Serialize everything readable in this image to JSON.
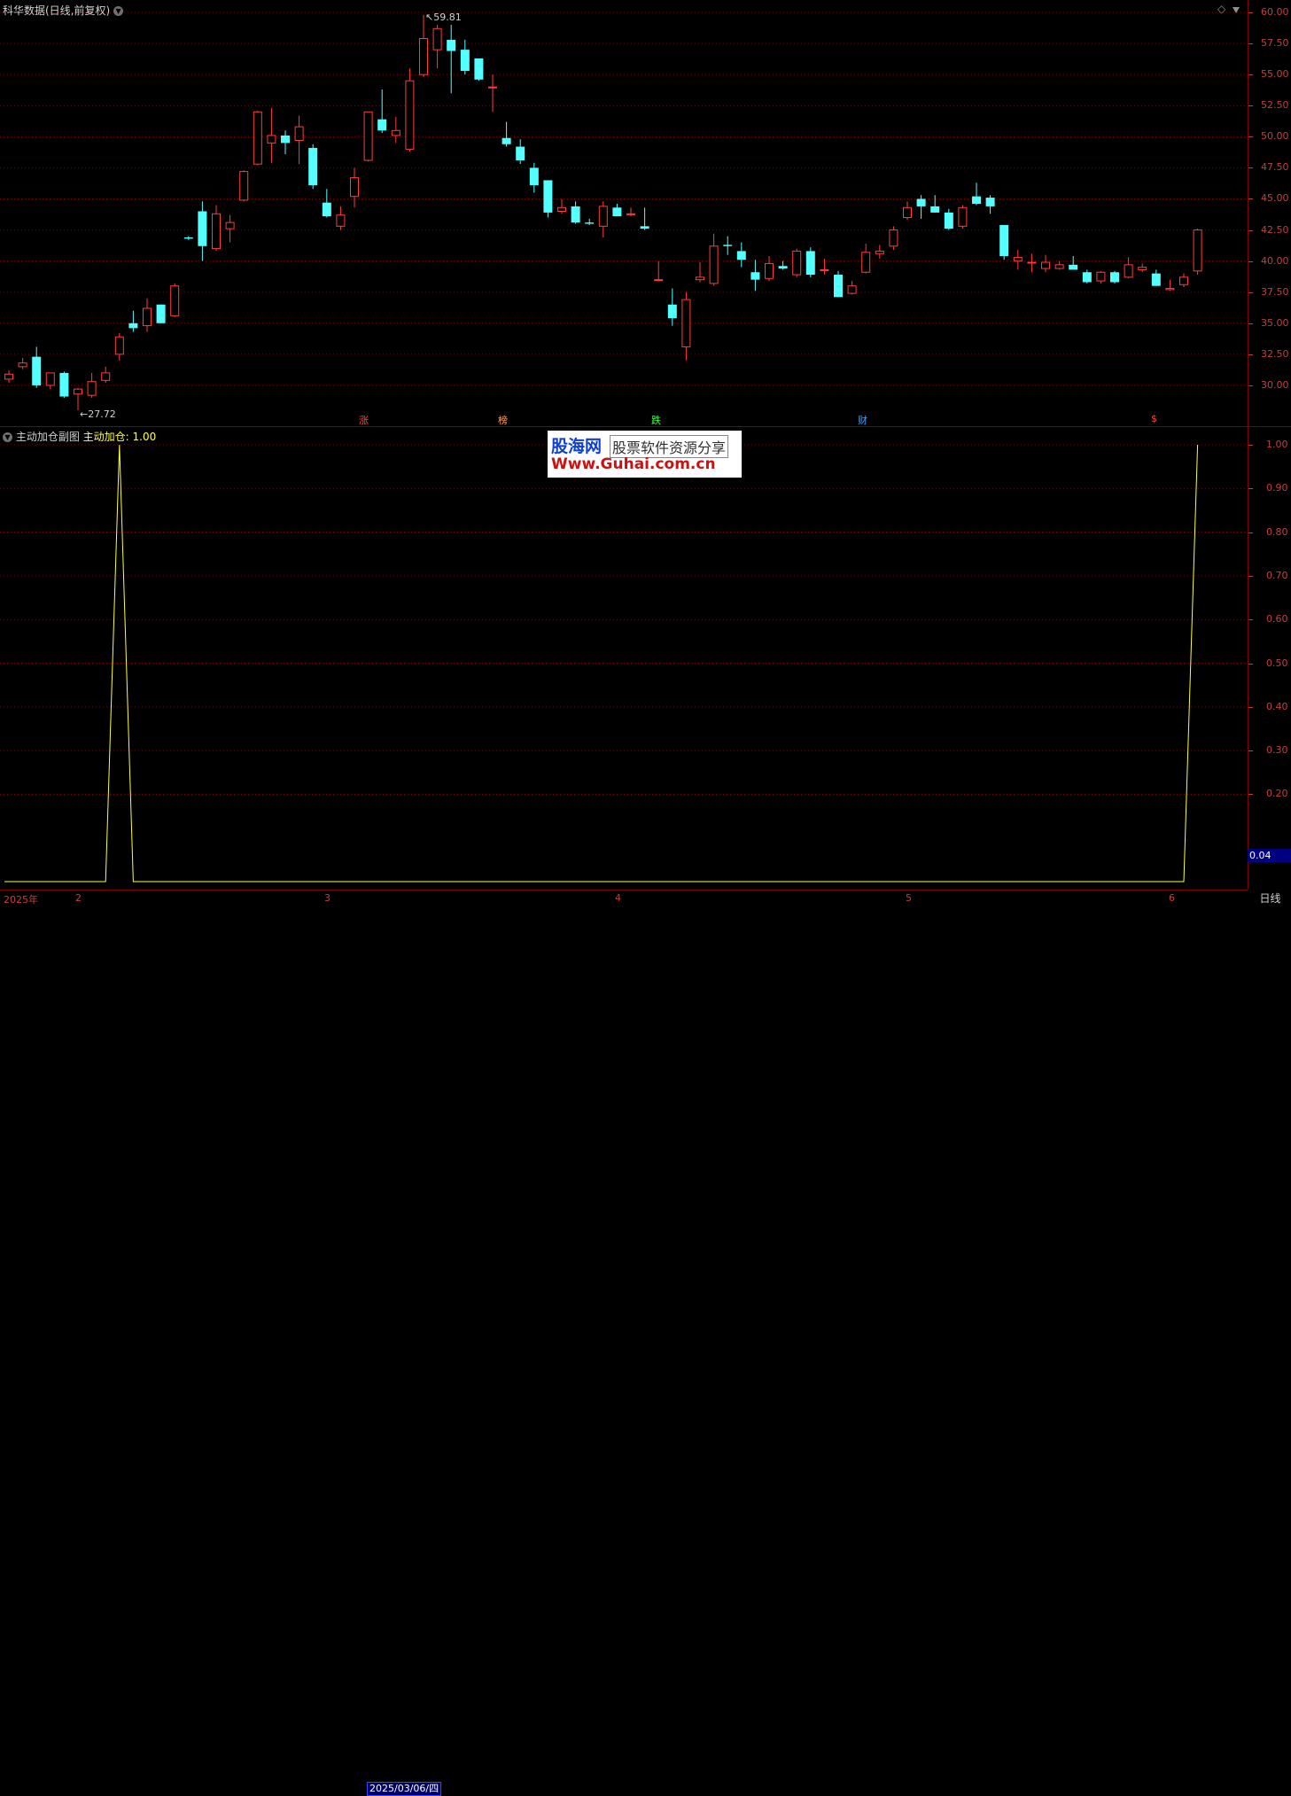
{
  "main_panel": {
    "title": "科华数据(日线,前复权)",
    "high_marker": "59.81",
    "low_marker": "27.72",
    "y_ticks": [
      "60.00",
      "57.50",
      "55.00",
      "52.50",
      "50.00",
      "47.50",
      "45.00",
      "42.50",
      "40.00",
      "37.50",
      "35.00",
      "32.50",
      "30.00"
    ],
    "event_tags": [
      {
        "label": "涨",
        "color": "#ff4040"
      },
      {
        "label": "榜",
        "color": "#ffa040"
      },
      {
        "label": "跌",
        "color": "#40ff40"
      },
      {
        "label": "财",
        "color": "#40a0ff"
      },
      {
        "label": "$",
        "color": "#ff4040"
      }
    ]
  },
  "sub_panel": {
    "title": "主动加仓副图",
    "indicator_label": "主动加仓: 1.00",
    "y_ticks": [
      "1.00",
      "0.90",
      "0.80",
      "0.70",
      "0.60",
      "0.50",
      "0.40",
      "0.30",
      "0.20"
    ],
    "last_value": "0.04"
  },
  "x_axis": {
    "labels": [
      "2025年",
      "2",
      "3",
      "2025/03/06/四",
      "4",
      "5",
      "6"
    ],
    "period": "日线"
  },
  "watermark": {
    "name": "股海网",
    "slogan": "股票软件资源分享",
    "url": "Www.Guhai.com.cn"
  },
  "colors": {
    "up": "#ff3c3c",
    "down": "#54ffff",
    "line": "#ffff40",
    "grid": "#800000"
  },
  "chart_data": [
    {
      "type": "candlestick",
      "title": "科华数据(日线,前复权)",
      "ylim": [
        27.0,
        61.0
      ],
      "series": [
        {
          "values": [
            [
              30.5,
              31.2,
              30.2,
              30.9
            ],
            [
              31.5,
              32.2,
              31.3,
              31.8
            ],
            [
              32.3,
              33.1,
              29.8,
              30.0
            ],
            [
              30.0,
              31.0,
              29.7,
              31.0
            ],
            [
              31.0,
              31.1,
              29.0,
              29.1
            ],
            [
              29.3,
              29.8,
              28.0,
              29.7
            ],
            [
              29.2,
              31.0,
              29.0,
              30.3
            ],
            [
              30.4,
              31.5,
              30.2,
              31.0
            ],
            [
              32.5,
              34.2,
              32.0,
              33.9
            ],
            [
              35.0,
              36.0,
              34.3,
              34.6
            ],
            [
              34.8,
              37.0,
              34.3,
              36.2
            ],
            [
              36.5,
              36.5,
              35.0,
              35.0
            ],
            [
              35.6,
              38.2,
              35.5,
              38.0
            ],
            [
              41.9,
              42.0,
              41.7,
              41.8
            ],
            [
              44.0,
              44.8,
              40.0,
              41.2
            ],
            [
              41.0,
              44.5,
              40.8,
              43.8
            ],
            [
              42.6,
              43.7,
              41.5,
              43.1
            ],
            [
              44.9,
              47.3,
              44.8,
              47.2
            ],
            [
              47.8,
              52.1,
              47.7,
              52.0
            ],
            [
              49.5,
              52.3,
              47.9,
              50.1
            ],
            [
              50.1,
              50.5,
              48.6,
              49.5
            ],
            [
              49.7,
              51.7,
              47.8,
              50.8
            ],
            [
              49.1,
              49.4,
              45.8,
              46.1
            ],
            [
              44.7,
              45.8,
              43.5,
              43.6
            ],
            [
              42.8,
              44.4,
              42.5,
              43.7
            ],
            [
              45.2,
              47.5,
              44.3,
              46.7
            ],
            [
              48.1,
              52.0,
              48.0,
              52.0
            ],
            [
              51.4,
              53.8,
              50.3,
              50.5
            ],
            [
              50.1,
              51.6,
              49.5,
              50.5
            ],
            [
              49.0,
              55.5,
              48.8,
              54.5
            ],
            [
              55.0,
              59.8,
              54.8,
              57.9
            ],
            [
              57.0,
              59.0,
              55.5,
              58.7
            ],
            [
              57.8,
              59.0,
              53.5,
              56.9
            ],
            [
              57.0,
              57.8,
              55.0,
              55.3
            ],
            [
              56.3,
              56.3,
              54.5,
              54.6
            ],
            [
              54.0,
              55.0,
              52.0,
              54.0
            ],
            [
              49.9,
              51.2,
              49.2,
              49.4
            ],
            [
              49.2,
              49.8,
              47.8,
              48.1
            ],
            [
              47.5,
              47.9,
              45.5,
              46.1
            ],
            [
              46.5,
              46.5,
              43.5,
              43.9
            ],
            [
              44.0,
              45.0,
              43.8,
              44.3
            ],
            [
              44.4,
              44.8,
              43.0,
              43.1
            ],
            [
              43.1,
              43.4,
              42.9,
              43.0
            ],
            [
              42.8,
              44.8,
              41.9,
              44.4
            ],
            [
              44.3,
              44.6,
              43.6,
              43.6
            ],
            [
              43.8,
              44.3,
              43.6,
              43.8
            ],
            [
              42.8,
              44.3,
              42.5,
              42.6
            ],
            [
              38.5,
              40.0,
              38.4,
              38.5
            ],
            [
              36.5,
              37.8,
              34.8,
              35.4
            ],
            [
              33.1,
              37.5,
              32.0,
              36.9
            ],
            [
              38.5,
              39.9,
              38.3,
              38.7
            ],
            [
              38.2,
              42.2,
              38.0,
              41.2
            ],
            [
              41.3,
              42.0,
              40.5,
              41.2
            ],
            [
              40.8,
              41.5,
              39.5,
              40.1
            ],
            [
              39.1,
              40.1,
              37.6,
              38.5
            ],
            [
              38.6,
              40.4,
              38.4,
              39.8
            ],
            [
              39.6,
              40.0,
              39.3,
              39.4
            ],
            [
              38.9,
              41.0,
              38.7,
              40.8
            ],
            [
              40.8,
              41.1,
              38.7,
              38.9
            ],
            [
              39.3,
              40.2,
              38.9,
              39.3
            ],
            [
              38.9,
              39.2,
              37.1,
              37.1
            ],
            [
              37.4,
              38.4,
              37.3,
              38.0
            ],
            [
              39.1,
              41.4,
              39.0,
              40.7
            ],
            [
              40.6,
              41.3,
              40.2,
              40.8
            ],
            [
              41.2,
              42.8,
              40.9,
              42.5
            ],
            [
              43.5,
              44.8,
              43.3,
              44.3
            ],
            [
              45.0,
              45.3,
              43.4,
              44.4
            ],
            [
              44.4,
              45.3,
              43.9,
              43.9
            ],
            [
              43.9,
              44.2,
              42.5,
              42.6
            ],
            [
              42.8,
              44.5,
              42.6,
              44.3
            ],
            [
              45.2,
              46.3,
              44.5,
              44.6
            ],
            [
              45.1,
              45.3,
              43.8,
              44.4
            ],
            [
              42.9,
              42.9,
              40.1,
              40.4
            ],
            [
              40.0,
              40.9,
              39.3,
              40.3
            ],
            [
              39.9,
              40.6,
              39.1,
              39.9
            ],
            [
              39.4,
              40.5,
              39.1,
              39.9
            ],
            [
              39.4,
              40.0,
              39.3,
              39.7
            ],
            [
              39.7,
              40.4,
              39.3,
              39.3
            ],
            [
              39.1,
              39.3,
              38.2,
              38.3
            ],
            [
              38.4,
              39.2,
              38.2,
              39.1
            ],
            [
              39.1,
              39.2,
              38.2,
              38.3
            ],
            [
              38.7,
              40.3,
              38.6,
              39.7
            ],
            [
              39.3,
              39.8,
              39.1,
              39.5
            ],
            [
              39.0,
              39.3,
              38.0,
              38.0
            ],
            [
              37.7,
              38.5,
              37.6,
              37.8
            ],
            [
              38.1,
              39.0,
              37.9,
              38.7
            ],
            [
              39.2,
              42.6,
              38.9,
              42.5
            ]
          ]
        }
      ]
    },
    {
      "type": "line",
      "title": "主动加仓副图",
      "ylim": [
        0.0,
        1.0
      ],
      "series": [
        {
          "name": "主动加仓",
          "points": [
            [
              0,
              0
            ],
            [
              7,
              0
            ],
            [
              8,
              1
            ],
            [
              9,
              0
            ],
            [
              85,
              0
            ],
            [
              86,
              1
            ]
          ]
        }
      ]
    }
  ]
}
